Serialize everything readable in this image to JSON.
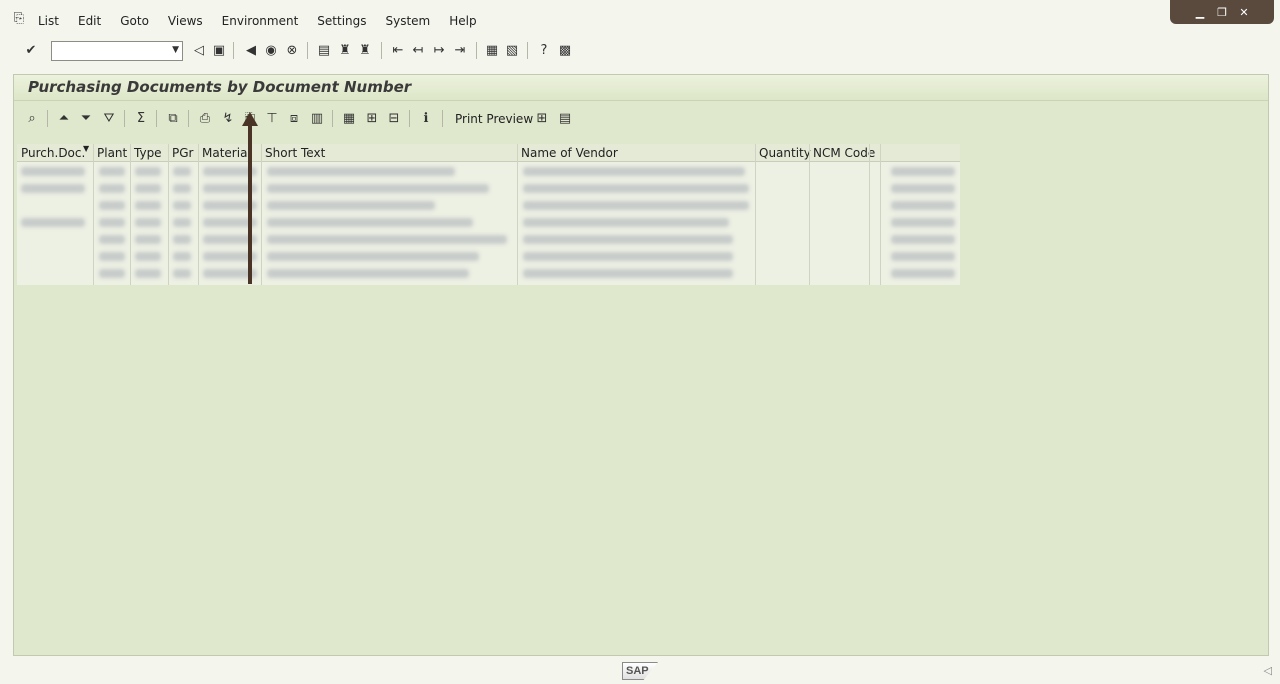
{
  "menu": {
    "items": [
      "List",
      "Edit",
      "Goto",
      "Views",
      "Environment",
      "Settings",
      "System",
      "Help"
    ]
  },
  "window_controls": [
    "minimize",
    "restore",
    "close"
  ],
  "command_field": {
    "value": ""
  },
  "page": {
    "title": "Purchasing Documents by Document Number"
  },
  "app_toolbar": {
    "print_preview_label": "Print Preview"
  },
  "grid": {
    "columns": [
      "Purch.Doc.",
      "Plant",
      "Type",
      "PGr",
      "Material",
      "Short Text",
      "Name of Vendor",
      "Quantity",
      "NCM Code"
    ]
  },
  "status": {
    "logo_text": "SAP",
    "right_icon": "◁"
  }
}
